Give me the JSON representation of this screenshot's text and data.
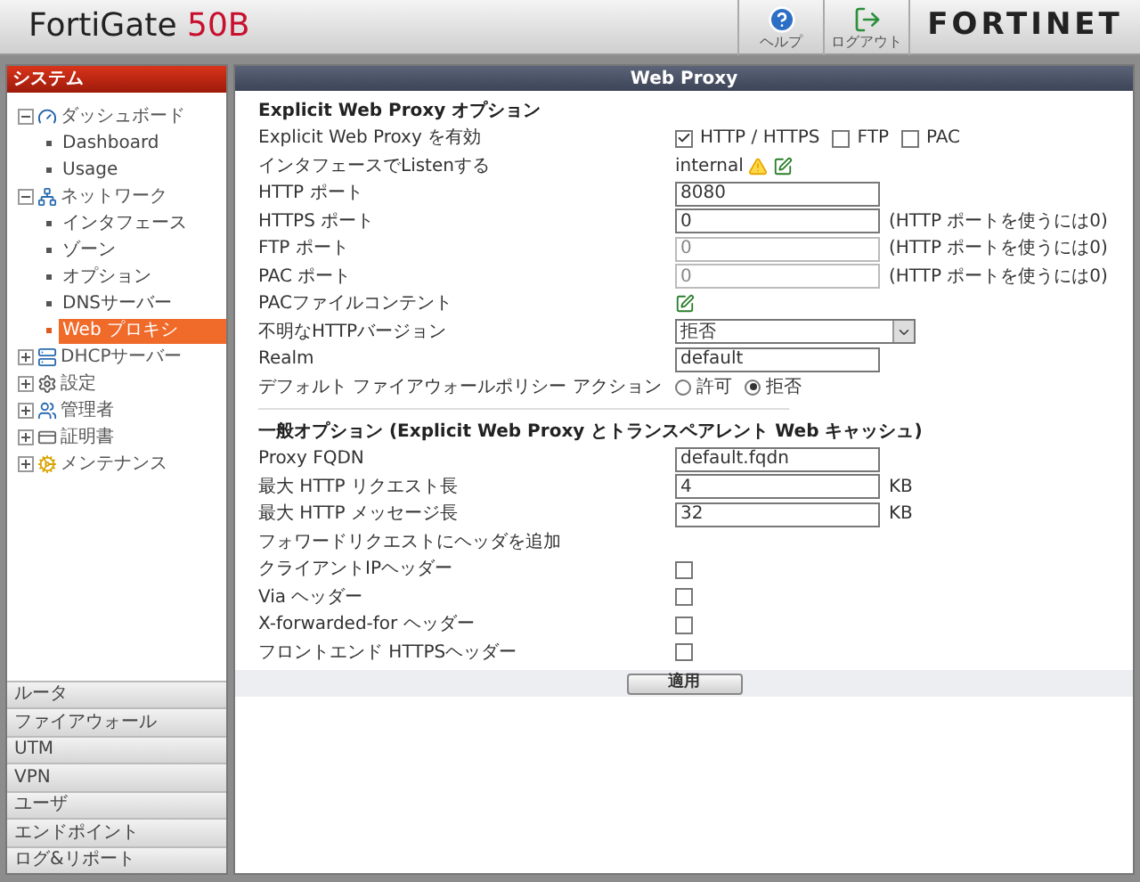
{
  "header": {
    "product": "FortiGate",
    "model": "50B",
    "buttons": [
      {
        "kind": "help",
        "label": "ヘルプ"
      },
      {
        "kind": "logout",
        "label": "ログアウト"
      }
    ],
    "logo": "FORTINET"
  },
  "sidebar": {
    "title": "システム",
    "tree": [
      {
        "label": "ダッシュボード",
        "expanded": true,
        "children": [
          {
            "label": "Dashboard",
            "selected": false
          },
          {
            "label": "Usage",
            "selected": false
          }
        ]
      },
      {
        "label": "ネットワーク",
        "expanded": true,
        "children": [
          {
            "label": "インタフェース",
            "selected": false
          },
          {
            "label": "ゾーン",
            "selected": false
          },
          {
            "label": "オプション",
            "selected": false
          },
          {
            "label": "DNSサーバー",
            "selected": false
          },
          {
            "label": "Web プロキシ",
            "selected": true
          }
        ]
      },
      {
        "label": "DHCPサーバー",
        "expanded": false
      },
      {
        "label": "設定",
        "expanded": false
      },
      {
        "label": "管理者",
        "expanded": false
      },
      {
        "label": "証明書",
        "expanded": false
      },
      {
        "label": "メンテナンス",
        "expanded": false
      }
    ],
    "sections": [
      "ルータ",
      "ファイアウォール",
      "UTM",
      "VPN",
      "ユーザ",
      "エンドポイント",
      "ログ&リポート"
    ]
  },
  "panel": {
    "title": "Web Proxy",
    "sections": [
      {
        "heading": "Explicit Web Proxy オプション",
        "rows": [
          {
            "kind": "checks",
            "label": "Explicit Web Proxy を有効",
            "options": [
              {
                "label": "HTTP / HTTPS",
                "checked": true
              },
              {
                "label": "FTP",
                "checked": false
              },
              {
                "label": "PAC",
                "checked": false
              }
            ]
          },
          {
            "kind": "interface",
            "label": "インタフェースでListenする",
            "value": "internal"
          },
          {
            "kind": "input",
            "label": "HTTP ポート",
            "value": "8080",
            "disabled": false
          },
          {
            "kind": "input",
            "label": "HTTPS ポート",
            "value": "0",
            "disabled": false,
            "hint": "(HTTP ポートを使うには0)"
          },
          {
            "kind": "input",
            "label": "FTP ポート",
            "value": "0",
            "disabled": true,
            "hint": "(HTTP ポートを使うには0)"
          },
          {
            "kind": "input",
            "label": "PAC ポート",
            "value": "0",
            "disabled": true,
            "hint": "(HTTP ポートを使うには0)"
          },
          {
            "kind": "edit",
            "label": "PACファイルコンテント"
          },
          {
            "kind": "select",
            "label": "不明なHTTPバージョン",
            "value": "拒否"
          },
          {
            "kind": "input",
            "label": "Realm",
            "value": "default",
            "disabled": false
          },
          {
            "kind": "radio",
            "label": "デフォルト ファイアウォールポリシー アクション",
            "options": [
              {
                "label": "許可",
                "selected": false
              },
              {
                "label": "拒否",
                "selected": true
              }
            ]
          }
        ]
      },
      {
        "heading": "一般オプション (Explicit Web Proxy とトランスペアレント Web キャッシュ)",
        "rows": [
          {
            "kind": "input",
            "label": "Proxy FQDN",
            "value": "default.fqdn",
            "disabled": false
          },
          {
            "kind": "input",
            "label": "最大 HTTP リクエスト長",
            "value": "4",
            "disabled": false,
            "hint": "KB"
          },
          {
            "kind": "input",
            "label": "最大 HTTP メッセージ長",
            "value": "32",
            "disabled": false,
            "hint": "KB"
          },
          {
            "kind": "note",
            "label": "フォワードリクエストにヘッダを追加"
          },
          {
            "kind": "checkbox",
            "label": "クライアントIPヘッダー",
            "checked": false
          },
          {
            "kind": "checkbox",
            "label": "Via ヘッダー",
            "checked": false
          },
          {
            "kind": "checkbox",
            "label": "X-forwarded-for ヘッダー",
            "checked": false
          },
          {
            "kind": "checkbox",
            "label": "フロントエンド HTTPSヘッダー",
            "checked": false
          }
        ]
      }
    ],
    "apply": "適用"
  }
}
